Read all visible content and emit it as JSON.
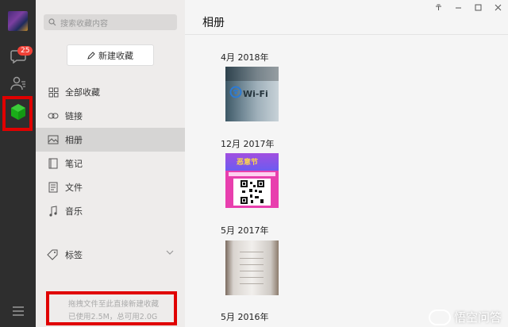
{
  "sidebar": {
    "unread_badge": "25",
    "icons": [
      "avatar",
      "chat-icon",
      "contacts-icon",
      "favorites-cube-icon",
      "menu-icon"
    ],
    "highlight_color": "#e00000"
  },
  "collections": {
    "search_placeholder": "搜索收藏内容",
    "new_button": "新建收藏",
    "nav": [
      {
        "label": "全部收藏",
        "icon": "grid-icon"
      },
      {
        "label": "链接",
        "icon": "link-icon"
      },
      {
        "label": "相册",
        "icon": "image-icon",
        "active": true
      },
      {
        "label": "笔记",
        "icon": "note-icon"
      },
      {
        "label": "文件",
        "icon": "file-icon"
      },
      {
        "label": "音乐",
        "icon": "music-icon"
      }
    ],
    "tags_label": "标签",
    "drop_hint": "拖拽文件至此直接新建收藏",
    "storage": "已使用2.5M，总可用2.0G"
  },
  "album": {
    "title": "相册",
    "groups": [
      {
        "date": "4月 2018年"
      },
      {
        "date": "12月 2017年",
        "poster_title": "恶意节"
      },
      {
        "date": "5月 2017年"
      },
      {
        "date": "5月 2016年"
      }
    ],
    "wifi_text": "Wi-Fi"
  },
  "watermark": "悟空问答"
}
